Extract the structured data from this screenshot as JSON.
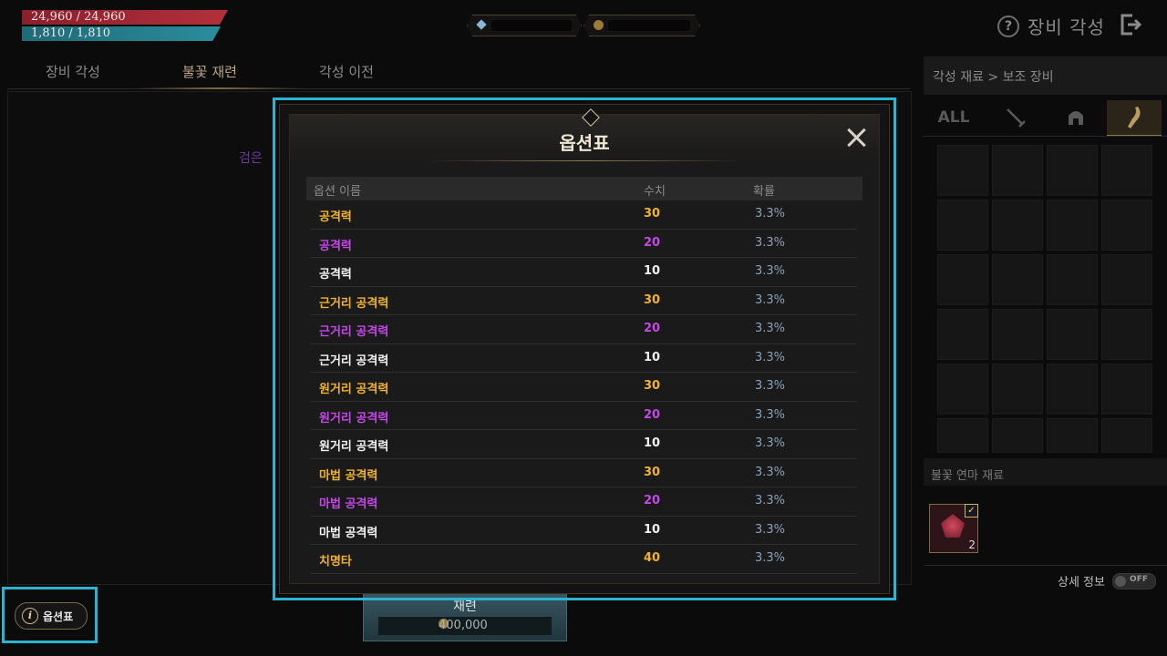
{
  "status": {
    "hp": "24,960 / 24,960",
    "mp": "1,810 / 1,810"
  },
  "header": {
    "title": "장비 각성",
    "help_icon": "?"
  },
  "tabs": [
    {
      "label": "장비 각성",
      "active": false
    },
    {
      "label": "불꽃 재련",
      "active": true
    },
    {
      "label": "각성 이전",
      "active": false
    }
  ],
  "background_text": "검은 ",
  "right_panel": {
    "breadcrumb": "각성 재료 > 보조 장비",
    "filter_tabs": [
      "ALL",
      "sword-icon",
      "helmet-icon",
      "horn-icon"
    ],
    "material_header": "불꽃 연마 재료",
    "material_count": "2",
    "detail_label": "상세 정보",
    "toggle_state": "OFF"
  },
  "refine": {
    "label": "재련",
    "cost": "400,000"
  },
  "option_button": {
    "icon": "i",
    "label": "옵션표"
  },
  "modal": {
    "title": "옵션표",
    "columns": {
      "name": "옵션 이름",
      "value": "수치",
      "prob": "확률"
    },
    "rows": [
      {
        "name": "공격력",
        "value": "30",
        "prob": "3.3%",
        "tier": "gold"
      },
      {
        "name": "공격력",
        "value": "20",
        "prob": "3.3%",
        "tier": "purple"
      },
      {
        "name": "공격력",
        "value": "10",
        "prob": "3.3%",
        "tier": "white"
      },
      {
        "name": "근거리 공격력",
        "value": "30",
        "prob": "3.3%",
        "tier": "gold"
      },
      {
        "name": "근거리 공격력",
        "value": "20",
        "prob": "3.3%",
        "tier": "purple"
      },
      {
        "name": "근거리 공격력",
        "value": "10",
        "prob": "3.3%",
        "tier": "white"
      },
      {
        "name": "원거리 공격력",
        "value": "30",
        "prob": "3.3%",
        "tier": "gold"
      },
      {
        "name": "원거리 공격력",
        "value": "20",
        "prob": "3.3%",
        "tier": "purple"
      },
      {
        "name": "원거리 공격력",
        "value": "10",
        "prob": "3.3%",
        "tier": "white"
      },
      {
        "name": "마법 공격력",
        "value": "30",
        "prob": "3.3%",
        "tier": "gold"
      },
      {
        "name": "마법 공격력",
        "value": "20",
        "prob": "3.3%",
        "tier": "purple"
      },
      {
        "name": "마법 공격력",
        "value": "10",
        "prob": "3.3%",
        "tier": "white"
      },
      {
        "name": "치명타",
        "value": "40",
        "prob": "3.3%",
        "tier": "gold"
      }
    ]
  }
}
